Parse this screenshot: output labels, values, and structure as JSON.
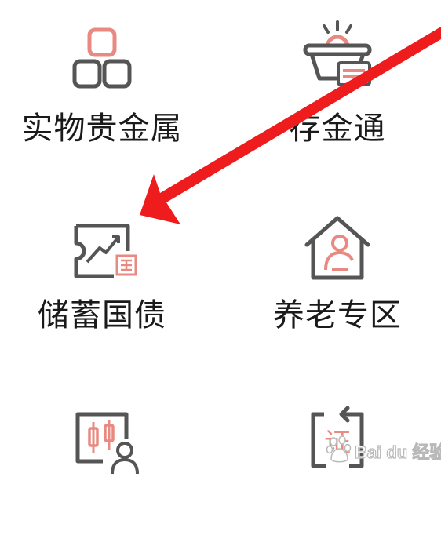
{
  "tiles": [
    {
      "label": "实物贵金属",
      "icon": "gold-bars-icon"
    },
    {
      "label": "存金通",
      "icon": "gold-bowl-card-icon"
    },
    {
      "label": "储蓄国债",
      "icon": "national-bond-ticket-icon"
    },
    {
      "label": "养老专区",
      "icon": "pension-house-icon"
    },
    {
      "label": "",
      "icon": "fund-advisor-icon"
    },
    {
      "label": "",
      "icon": "securities-refresh-icon"
    }
  ],
  "overlay": {
    "arrow_color": "#ee1c1c",
    "watermark": "Bai du 经验"
  },
  "colors": {
    "icon_gray": "#555555",
    "icon_accent": "#e88a82",
    "label": "#1a1a1a"
  }
}
